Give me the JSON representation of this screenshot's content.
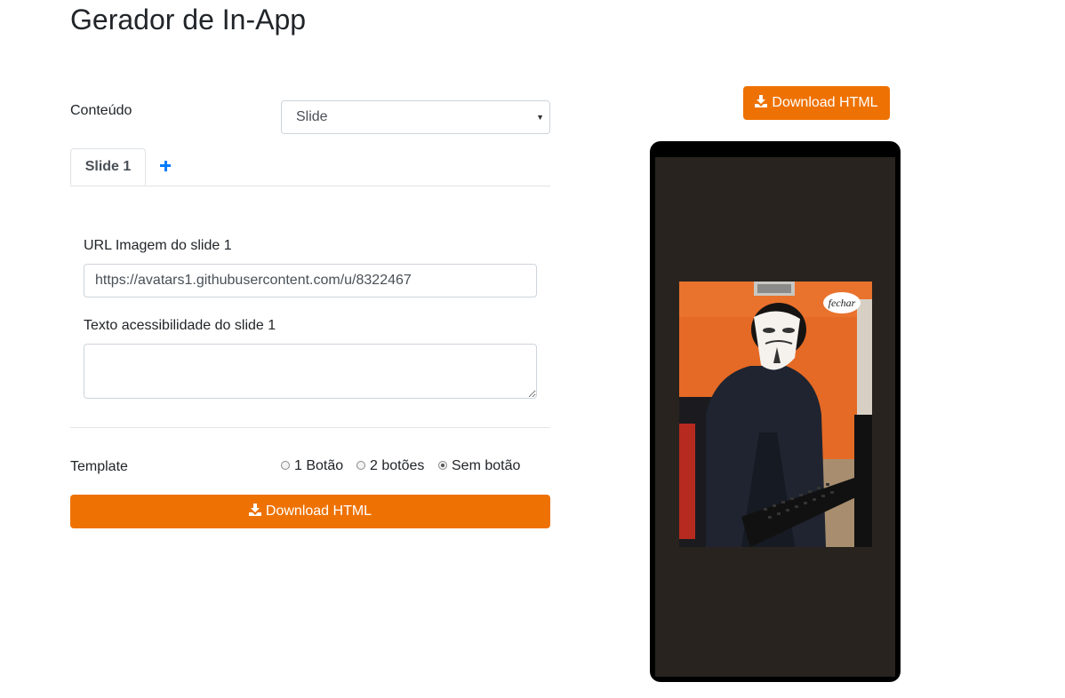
{
  "header": {
    "title": "Gerador de In-App"
  },
  "form": {
    "content_label": "Conteúdo",
    "content_select_value": "Slide",
    "tabs": [
      {
        "label": "Slide 1"
      }
    ],
    "slide": {
      "url_label": "URL Imagem do slide 1",
      "url_value": "https://avatars1.githubusercontent.com/u/8322467",
      "alt_label": "Texto acessibilidade do slide 1",
      "alt_value": ""
    },
    "template_label": "Template",
    "template_options": [
      {
        "label": "1 Botão",
        "checked": false
      },
      {
        "label": "2 botões",
        "checked": false
      },
      {
        "label": "Sem botão",
        "checked": true
      }
    ],
    "download_label": "Download HTML"
  },
  "preview": {
    "download_label": "Download HTML",
    "close_label": "fechar"
  },
  "colors": {
    "accent": "#ee7203",
    "link": "#007bff",
    "phone_screen": "#28231f"
  },
  "icons": [
    "plus-icon",
    "download-icon",
    "chevron-down-icon"
  ]
}
